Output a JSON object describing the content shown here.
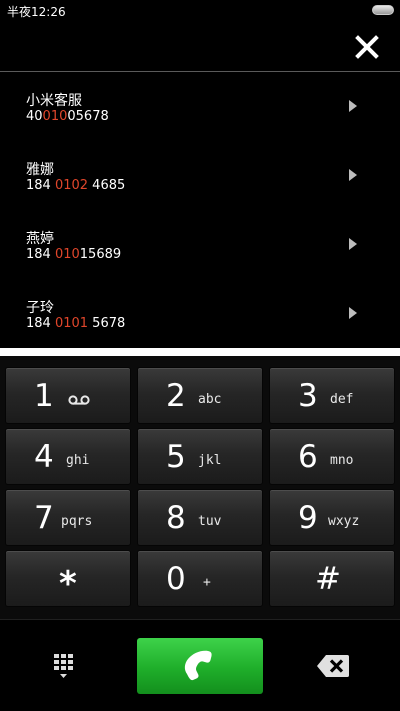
{
  "status_bar": {
    "time": "半夜12:26",
    "battery_icon": "battery-icon"
  },
  "header": {
    "close_icon": "close-icon"
  },
  "contacts": [
    {
      "name": "小米客服",
      "number_pre": "40",
      "number_hl": "010",
      "number_post": "05678"
    },
    {
      "name": "雅娜",
      "number_pre": "184 ",
      "number_hl": "0102",
      "number_post": " 4685"
    },
    {
      "name": "燕婷",
      "number_pre": "184 ",
      "number_hl": "010",
      "number_post": "15689"
    },
    {
      "name": "子玲",
      "number_pre": "184 ",
      "number_hl": "0101",
      "number_post": " 5678"
    }
  ],
  "keypad": {
    "keys": [
      {
        "digit": "1",
        "letters": "",
        "icon": "voicemail-icon"
      },
      {
        "digit": "2",
        "letters": "abc"
      },
      {
        "digit": "3",
        "letters": "def"
      },
      {
        "digit": "4",
        "letters": "ghi"
      },
      {
        "digit": "5",
        "letters": "jkl"
      },
      {
        "digit": "6",
        "letters": "mno"
      },
      {
        "digit": "7",
        "letters": "pqrs"
      },
      {
        "digit": "8",
        "letters": "tuv"
      },
      {
        "digit": "9",
        "letters": "wxyz"
      },
      {
        "digit": "*",
        "letters": ""
      },
      {
        "digit": "0",
        "letters": "+"
      },
      {
        "digit": "#",
        "letters": ""
      }
    ]
  },
  "bottom_bar": {
    "keypad_toggle_icon": "dialpad-icon",
    "call_icon": "phone-icon",
    "backspace_icon": "backspace-icon"
  },
  "colors": {
    "highlight": "#e0462b",
    "call_green": "#1fae2a",
    "background": "#000000"
  }
}
